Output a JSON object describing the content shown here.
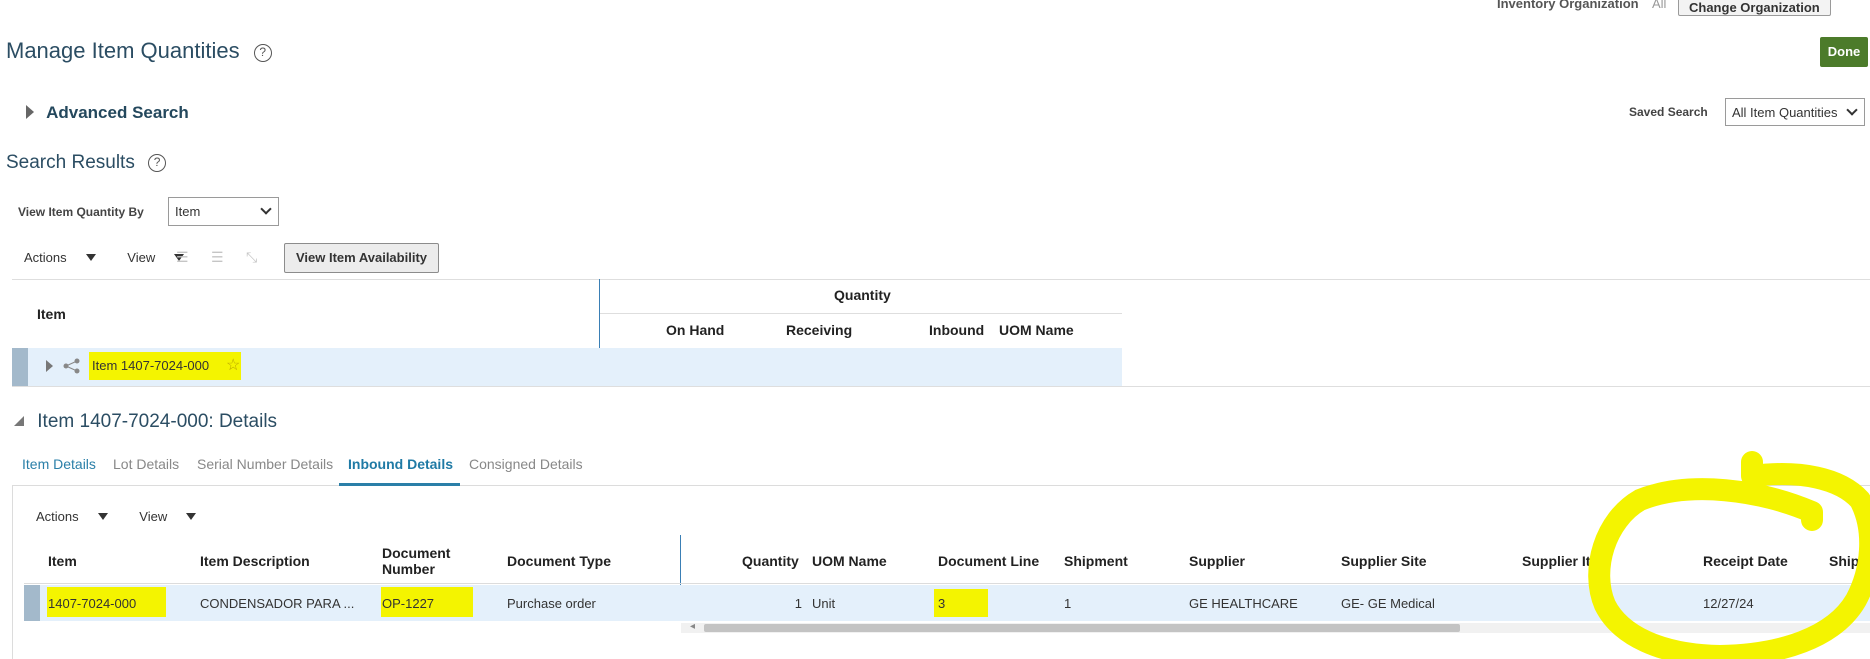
{
  "header": {
    "org_label": "Inventory Organization",
    "org_value": "All",
    "change_org_label": "Change Organization",
    "page_title": "Manage Item Quantities",
    "done_label": "Done"
  },
  "search": {
    "advanced_label": "Advanced Search",
    "saved_search_label": "Saved Search",
    "saved_search_value": "All Item Quantities"
  },
  "results": {
    "title": "Search Results",
    "view_by_label": "View Item Quantity By",
    "view_by_value": "Item",
    "actions_label": "Actions",
    "view_label": "View",
    "availability_button": "View Item Availability",
    "table": {
      "col_item": "Item",
      "group_quantity": "Quantity",
      "col_on_hand": "On Hand",
      "col_receiving": "Receiving",
      "col_inbound": "Inbound",
      "col_uom": "UOM Name",
      "row_item": "Item 1407-7024-000"
    }
  },
  "details": {
    "title": "Item 1407-7024-000: Details",
    "tabs": [
      "Item Details",
      "Lot Details",
      "Serial Number Details",
      "Inbound Details",
      "Consigned Details"
    ],
    "active_tab": "Inbound Details",
    "actions_label": "Actions",
    "view_label": "View",
    "columns": {
      "item": "Item",
      "item_description": "Item Description",
      "document_number_1": "Document",
      "document_number_2": "Number",
      "document_type": "Document Type",
      "quantity": "Quantity",
      "uom_name": "UOM Name",
      "document_line": "Document Line",
      "shipment": "Shipment",
      "supplier": "Supplier",
      "supplier_site": "Supplier Site",
      "supplier_item": "Supplier Item",
      "receipt_date": "Receipt Date",
      "shipment_truncated": "Shipp"
    },
    "row": {
      "item": "1407-7024-000",
      "item_description": "CONDENSADOR PARA ...",
      "document_number": "OP-1227",
      "document_type": "Purchase order",
      "quantity": "1",
      "uom_name": "Unit",
      "document_line": "3",
      "shipment": "1",
      "supplier": "GE HEALTHCARE",
      "supplier_site": "GE- GE Medical",
      "supplier_item": "",
      "receipt_date": "12/27/24"
    }
  },
  "colors": {
    "title": "#2b4d63",
    "done_button": "#4c7b2a",
    "highlight": "#f4f400",
    "row_selected": "#e4f0fb",
    "active_tab": "#1f7aa5"
  }
}
